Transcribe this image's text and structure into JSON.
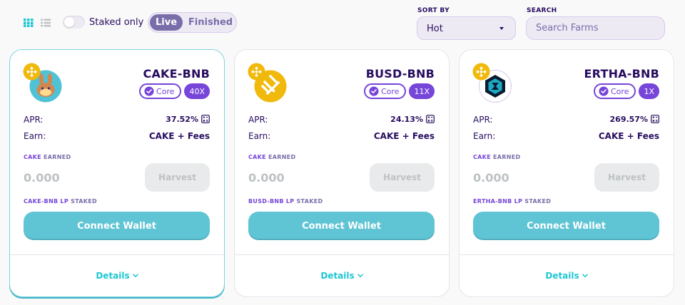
{
  "toolbar": {
    "staked_only_label": "Staked only",
    "tabs": [
      {
        "label": "Live",
        "active": true
      },
      {
        "label": "Finished",
        "active": false
      }
    ],
    "sort_by": {
      "label": "SORT BY",
      "value": "Hot"
    },
    "search": {
      "label": "SEARCH",
      "placeholder": "Search Farms"
    }
  },
  "colors": {
    "primary": "#7645D9",
    "secondary": "#7A6EAA",
    "text": "#280D5F",
    "connect_button": "#5FC4D3",
    "details_link": "#1FC7D4",
    "disabled": "#BDC2C4"
  },
  "farms": [
    {
      "pair": "CAKE-BNB",
      "token_icon": "pancake-bunny-icon",
      "quote_icon": "bnb-icon",
      "core_label": "Core",
      "multiplier": "40X",
      "apr_label": "APR:",
      "apr": "37.52%",
      "earn_label": "Earn:",
      "earn": "CAKE + Fees",
      "earned_token": "CAKE",
      "earned_suffix": "EARNED",
      "earned_amount": "0.000",
      "harvest_label": "Harvest",
      "staked_token": "CAKE-BNB LP",
      "staked_suffix": "STAKED",
      "connect_label": "Connect Wallet",
      "details_label": "Details"
    },
    {
      "pair": "BUSD-BNB",
      "token_icon": "busd-icon",
      "quote_icon": "bnb-icon",
      "core_label": "Core",
      "multiplier": "11X",
      "apr_label": "APR:",
      "apr": "24.13%",
      "earn_label": "Earn:",
      "earn": "CAKE + Fees",
      "earned_token": "CAKE",
      "earned_suffix": "EARNED",
      "earned_amount": "0.000",
      "harvest_label": "Harvest",
      "staked_token": "BUSD-BNB LP",
      "staked_suffix": "STAKED",
      "connect_label": "Connect Wallet",
      "details_label": "Details"
    },
    {
      "pair": "ERTHA-BNB",
      "token_icon": "ertha-icon",
      "quote_icon": "bnb-icon",
      "core_label": "Core",
      "multiplier": "1X",
      "apr_label": "APR:",
      "apr": "269.57%",
      "earn_label": "Earn:",
      "earn": "CAKE + Fees",
      "earned_token": "CAKE",
      "earned_suffix": "EARNED",
      "earned_amount": "0.000",
      "harvest_label": "Harvest",
      "staked_token": "ERTHA-BNB LP",
      "staked_suffix": "STAKED",
      "connect_label": "Connect Wallet",
      "details_label": "Details"
    }
  ]
}
